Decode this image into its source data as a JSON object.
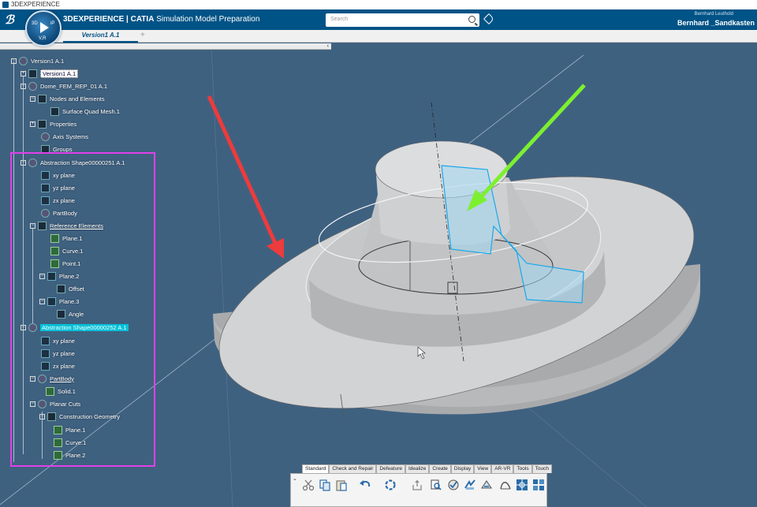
{
  "titlebar": {
    "text": "3DEXPERIENCE"
  },
  "header": {
    "brand": "3DEXPERIENCE | CATIA",
    "app": "Simulation Model Preparation",
    "search_placeholder": "Search",
    "user_small": "Bernhard Leuthold",
    "user_big": "Bernhard _Sandkasten",
    "compass": {
      "top": "3D",
      "right": "iP",
      "left": "V,R"
    }
  },
  "tabs": [
    {
      "label": "Version1 A.1"
    }
  ],
  "tree": [
    {
      "label": "Version1 A.1",
      "depth": 0
    },
    {
      "label": "Version1 A.1",
      "depth": 1
    },
    {
      "label": "Dome_FEM_REP_01 A.1",
      "depth": 1
    },
    {
      "label": "Nodes and Elements",
      "depth": 2
    },
    {
      "label": "Surface Quad Mesh.1",
      "depth": 3
    },
    {
      "label": "Properties",
      "depth": 2
    },
    {
      "label": "Axis Systems",
      "depth": 2
    },
    {
      "label": "Groups",
      "depth": 2
    },
    {
      "label": "Abstraction Shape00000251 A.1",
      "depth": 1
    },
    {
      "label": "xy plane",
      "depth": 2
    },
    {
      "label": "yz plane",
      "depth": 2
    },
    {
      "label": "zx plane",
      "depth": 2
    },
    {
      "label": "PartBody",
      "depth": 2
    },
    {
      "label": "Reference Elements",
      "depth": 2
    },
    {
      "label": "Plane.1",
      "depth": 3
    },
    {
      "label": "Curve.1",
      "depth": 3
    },
    {
      "label": "Point.1",
      "depth": 3
    },
    {
      "label": "Plane.2",
      "depth": 3
    },
    {
      "label": "Offset",
      "depth": 4
    },
    {
      "label": "Plane.3",
      "depth": 3
    },
    {
      "label": "Angle",
      "depth": 4
    },
    {
      "label": "Abstraction Shape00000252 A.1",
      "depth": 1
    },
    {
      "label": "xy plane",
      "depth": 2
    },
    {
      "label": "yz plane",
      "depth": 2
    },
    {
      "label": "zx plane",
      "depth": 2
    },
    {
      "label": "PartBody",
      "depth": 2
    },
    {
      "label": "Solid.1",
      "depth": 3
    },
    {
      "label": "Planar Cuts",
      "depth": 2
    },
    {
      "label": "Construction Geometry",
      "depth": 3
    },
    {
      "label": "Plane.1",
      "depth": 4
    },
    {
      "label": "Curve.1",
      "depth": 4
    },
    {
      "label": "Plane.2",
      "depth": 4
    }
  ],
  "toolbar_tabs": [
    "Standard",
    "Check and Repair",
    "Defeature",
    "Idealize",
    "Create",
    "Display",
    "View",
    "AR-VR",
    "Tools",
    "Touch"
  ],
  "colors": {
    "header": "#005386",
    "viewport": "#3f6180",
    "highlight_box": "#e040e8",
    "arrow_red": "#ee3b3b",
    "arrow_green": "#7cf030"
  }
}
